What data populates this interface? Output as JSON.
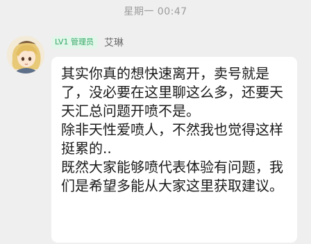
{
  "header": {
    "timestamp": "星期一 00:47"
  },
  "message": {
    "sender": {
      "badge": "LV1 管理员",
      "name": "艾琳",
      "avatar_icon": "anime-character-avatar"
    },
    "paragraphs": [
      "其实你真的想快速离开，卖号就是了，没必要在这里聊这么多，还要天天汇总问题开喷不是。",
      "除非天性爱喷人，不然我也觉得这样挺累的..",
      "既然大家能够喷代表体验有问题，我们是希望多能从大家这里获取建议。"
    ]
  },
  "colors": {
    "background": "#efefef",
    "bubble": "#ffffff",
    "badge_bg": "#e2f6ea",
    "badge_text": "#35a866"
  }
}
